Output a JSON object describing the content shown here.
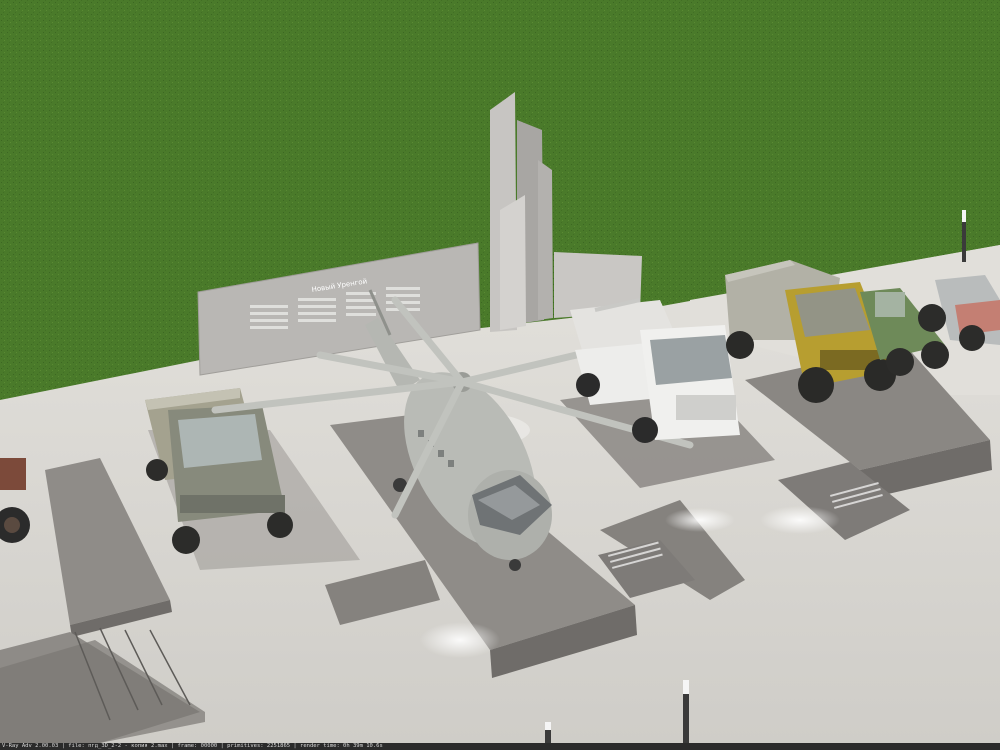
{
  "scene": {
    "description_tag": "architectural render: open-air military/machinery display with stele and vehicles on plinths",
    "colors": {
      "grass": "#4a7a2a",
      "grass_dark": "#3a6420",
      "pavement": "#d9d7d2",
      "plinth": "#8e8b87",
      "plinth_side": "#6f6c69",
      "stele": "#b8b6b3",
      "truck_olive": "#8b8e7f",
      "truck_yellow": "#b8a032",
      "tractor_green": "#6f8a5a",
      "helicopter": "#b7b9b4",
      "tanker_white": "#e8e8e6",
      "render_bar": "#2b2b2b"
    },
    "stele_title": "Новый Уренгой",
    "icons": [
      "helicopter",
      "truck",
      "tanker-truck",
      "tractor",
      "stele",
      "bollard-light"
    ]
  },
  "render_bar": {
    "text": "V-Ray Adv 2.00.03 | file: пгд_3D_2-2 - копия 2.max | frame: 00000 | primitives: 2251865 | render time: 0h 39m 10.6s"
  }
}
